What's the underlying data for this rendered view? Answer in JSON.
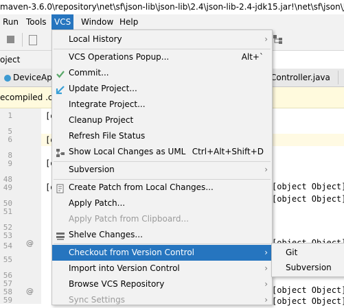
{
  "window": {
    "title": "maven-3.6.0\\repository\\net\\sf\\json-lib\\json-lib\\2.4\\json-lib-2.4-jdk15.jar!\\net\\sf\\json\\J"
  },
  "menubar": {
    "items": [
      {
        "label": "Run"
      },
      {
        "label": "Tools"
      },
      {
        "label": "VCS"
      },
      {
        "label": "Window"
      },
      {
        "label": "Help"
      }
    ]
  },
  "project_panel": {
    "label": "oject"
  },
  "tabs": [
    {
      "label": "DeviceApiC"
    },
    {
      "label": "Controller.java"
    }
  ],
  "decompiled_bar": {
    "text": "ecompiled .cl"
  },
  "editor": {
    "line_numbers": [
      "1",
      "5",
      "6",
      "8",
      "9",
      "48",
      "49",
      "50",
      "51",
      "52",
      "53",
      "54",
      "55",
      "56",
      "57",
      "58",
      "59",
      "60",
      "61",
      "62"
    ],
    "code_fragments": [
      {
        "text": "stractJSON imp"
      },
      {
        "text": "tory.getLog(J"
      },
      {
        "text": "bject object)"
      },
      {
        "text": "Object object,"
      },
      {
        "text": "isNull(object"
      },
      {
        "text": "A"
      },
      {
        "text": "p"
      },
      {
        "text": "i"
      },
      {
        "text": "p"
      }
    ]
  },
  "vcs_menu": {
    "items": [
      {
        "label": "Local History",
        "shortcut": "",
        "submenu": true,
        "icon": ""
      },
      {
        "label": "VCS Operations Popup...",
        "shortcut": "Alt+`",
        "submenu": false,
        "icon": ""
      },
      {
        "label": "Commit...",
        "shortcut": "",
        "submenu": false,
        "icon": "check-icon"
      },
      {
        "label": "Update Project...",
        "shortcut": "",
        "submenu": false,
        "icon": "update-arrow-icon"
      },
      {
        "label": "Integrate Project...",
        "shortcut": "",
        "submenu": false,
        "icon": ""
      },
      {
        "label": "Cleanup Project",
        "shortcut": "",
        "submenu": false,
        "icon": ""
      },
      {
        "label": "Refresh File Status",
        "shortcut": "",
        "submenu": false,
        "icon": ""
      },
      {
        "label": "Show Local Changes as UML",
        "shortcut": "Ctrl+Alt+Shift+D",
        "submenu": false,
        "icon": "uml-icon"
      },
      {
        "label": "Subversion",
        "shortcut": "",
        "submenu": true,
        "icon": ""
      },
      {
        "label": "Create Patch from Local Changes...",
        "shortcut": "",
        "submenu": false,
        "icon": "patch-icon"
      },
      {
        "label": "Apply Patch...",
        "shortcut": "",
        "submenu": false,
        "icon": ""
      },
      {
        "label": "Apply Patch from Clipboard...",
        "shortcut": "",
        "submenu": false,
        "icon": "",
        "disabled": true
      },
      {
        "label": "Shelve Changes...",
        "shortcut": "",
        "submenu": false,
        "icon": "shelve-icon"
      },
      {
        "label": "Checkout from Version Control",
        "shortcut": "",
        "submenu": true,
        "icon": "",
        "selected": true
      },
      {
        "label": "Import into Version Control",
        "shortcut": "",
        "submenu": true,
        "icon": ""
      },
      {
        "label": "Browse VCS Repository",
        "shortcut": "",
        "submenu": true,
        "icon": ""
      },
      {
        "label": "Sync Settings",
        "shortcut": "",
        "submenu": true,
        "icon": "",
        "disabled": true
      }
    ]
  },
  "checkout_submenu": {
    "items": [
      {
        "label": "Git"
      },
      {
        "label": "Subversion"
      }
    ]
  },
  "colors": {
    "selection": "#2675bf",
    "menu_bg": "#f2f2f2",
    "check_green": "#59a869",
    "update_blue": "#389fd6"
  }
}
